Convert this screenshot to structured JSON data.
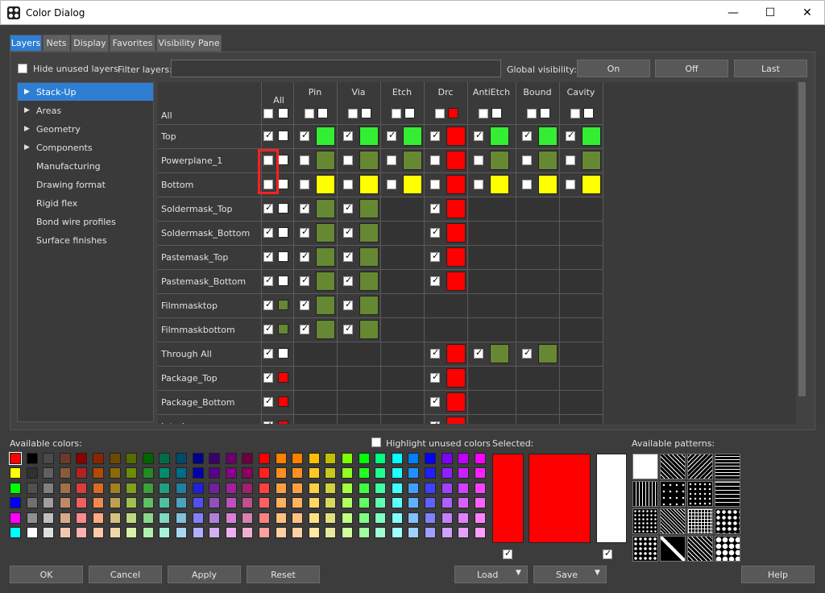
{
  "window": {
    "title": "Color Dialog",
    "minimize": "—",
    "maximize": "☐",
    "close": "✕"
  },
  "tabs": [
    "Layers",
    "Nets",
    "Display",
    "Favorites",
    "Visibility Pane"
  ],
  "toolbar": {
    "hide_unused": "Hide unused layers",
    "filter_label": "Filter layers:",
    "filter_value": "",
    "global_label": "Global visibility:",
    "on": "On",
    "off": "Off",
    "last": "Last"
  },
  "tree": [
    "Stack-Up",
    "Areas",
    "Geometry",
    "Components",
    "Manufacturing",
    "Drawing format",
    "Rigid flex",
    "Bond wire profiles",
    "Surface finishes"
  ],
  "columns": {
    "all": "All",
    "headers": [
      "Pin",
      "Via",
      "Etch",
      "Drc",
      "AntiEtch",
      "Bound",
      "Cavity"
    ],
    "all_row": "All"
  },
  "colors": {
    "red": "#ff0000",
    "green": "#33ee33",
    "olive": "#668833",
    "yellow": "#ffff00",
    "white": "#ffffff",
    "accent": "#2e7fd3"
  },
  "rows": [
    {
      "name": "Top",
      "all": [
        true,
        "white"
      ],
      "cells": [
        [
          true,
          "green"
        ],
        [
          true,
          "green"
        ],
        [
          true,
          "green"
        ],
        [
          true,
          "red"
        ],
        [
          true,
          "green"
        ],
        [
          true,
          "green"
        ],
        [
          true,
          "green"
        ]
      ]
    },
    {
      "name": "Powerplane_1",
      "all": [
        false,
        "white"
      ],
      "cells": [
        [
          false,
          "olive"
        ],
        [
          false,
          "olive"
        ],
        [
          false,
          "olive"
        ],
        [
          false,
          "red"
        ],
        [
          false,
          "olive"
        ],
        [
          false,
          "olive"
        ],
        [
          false,
          "olive"
        ]
      ]
    },
    {
      "name": "Bottom",
      "all": [
        false,
        "white"
      ],
      "cells": [
        [
          false,
          "yellow"
        ],
        [
          false,
          "yellow"
        ],
        [
          false,
          "yellow"
        ],
        [
          false,
          "red"
        ],
        [
          false,
          "yellow"
        ],
        [
          false,
          "yellow"
        ],
        [
          false,
          "yellow"
        ]
      ]
    },
    {
      "name": "Soldermask_Top",
      "all": [
        true,
        "white"
      ],
      "cells": [
        [
          true,
          "olive"
        ],
        [
          true,
          "olive"
        ],
        null,
        [
          true,
          "red"
        ],
        null,
        null,
        null
      ]
    },
    {
      "name": "Soldermask_Bottom",
      "all": [
        true,
        "white"
      ],
      "cells": [
        [
          true,
          "olive"
        ],
        [
          true,
          "olive"
        ],
        null,
        [
          true,
          "red"
        ],
        null,
        null,
        null
      ]
    },
    {
      "name": "Pastemask_Top",
      "all": [
        true,
        "white"
      ],
      "cells": [
        [
          true,
          "olive"
        ],
        [
          true,
          "olive"
        ],
        null,
        [
          true,
          "red"
        ],
        null,
        null,
        null
      ]
    },
    {
      "name": "Pastemask_Bottom",
      "all": [
        true,
        "white"
      ],
      "cells": [
        [
          true,
          "olive"
        ],
        [
          true,
          "olive"
        ],
        null,
        [
          true,
          "red"
        ],
        null,
        null,
        null
      ]
    },
    {
      "name": "Filmmasktop",
      "all": [
        true,
        "olive"
      ],
      "cells": [
        [
          true,
          "olive"
        ],
        [
          true,
          "olive"
        ],
        null,
        null,
        null,
        null,
        null
      ]
    },
    {
      "name": "Filmmaskbottom",
      "all": [
        true,
        "olive"
      ],
      "cells": [
        [
          true,
          "olive"
        ],
        [
          true,
          "olive"
        ],
        null,
        null,
        null,
        null,
        null
      ]
    },
    {
      "name": "Through All",
      "all": [
        true,
        "white"
      ],
      "cells": [
        null,
        null,
        null,
        [
          true,
          "red"
        ],
        [
          true,
          "olive"
        ],
        [
          true,
          "olive"
        ],
        null
      ]
    },
    {
      "name": "Package_Top",
      "all": [
        true,
        "red"
      ],
      "cells": [
        null,
        null,
        null,
        [
          true,
          "red"
        ],
        null,
        null,
        null
      ]
    },
    {
      "name": "Package_Bottom",
      "all": [
        true,
        "red"
      ],
      "cells": [
        null,
        null,
        null,
        [
          true,
          "red"
        ],
        null,
        null,
        null
      ]
    },
    {
      "name": "Interl...",
      "all": [
        true,
        "red"
      ],
      "cells": [
        null,
        null,
        null,
        [
          true,
          "red"
        ],
        null,
        null,
        null
      ]
    }
  ],
  "bottom": {
    "available_colors": "Available colors:",
    "highlight_unused": "Highlight unused colors",
    "selected": "Selected:",
    "available_patterns": "Available patterns:"
  },
  "buttons": {
    "ok": "OK",
    "cancel": "Cancel",
    "apply": "Apply",
    "reset": "Reset",
    "load": "Load",
    "save": "Save",
    "help": "Help"
  }
}
